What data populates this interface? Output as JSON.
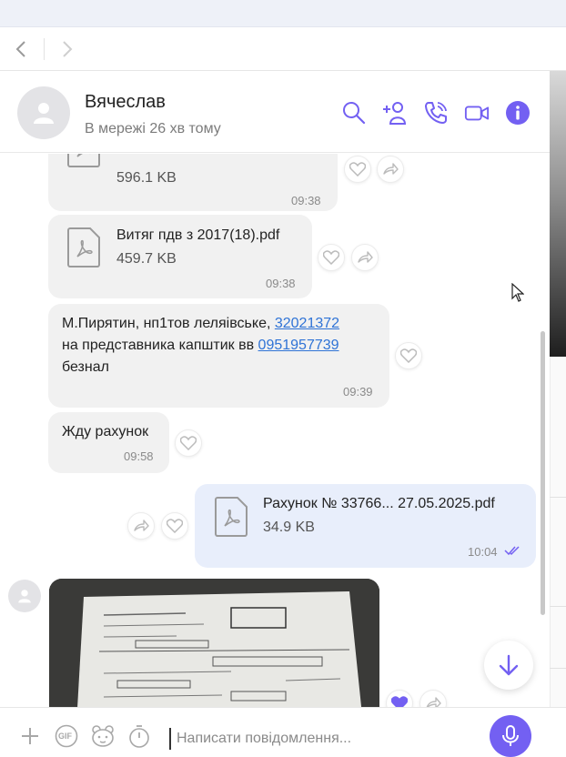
{
  "header": {
    "contact_name": "Вячеслав",
    "status": "В мережі 26 хв тому"
  },
  "messages": {
    "m1": {
      "size": "596.1 KB",
      "time": "09:38"
    },
    "m2": {
      "file_name": "Витяг пдв з 2017(18).pdf",
      "size": "459.7 KB",
      "time": "09:38"
    },
    "m3": {
      "line1_text": "М.Пирятин, нп1тов леляівське, ",
      "line1_link": "32021372",
      "line2_text": "на представника капштик вв ",
      "line2_link": "0951957739",
      "line3_text": "безнал",
      "time": "09:39"
    },
    "m4": {
      "text": "Жду рахунок",
      "time": "09:58"
    },
    "m5": {
      "file_name": "Рахунок № 33766... 27.05.2025.pdf",
      "size": "34.9 KB",
      "time": "10:04"
    }
  },
  "composer": {
    "placeholder": "Написати повідомлення...",
    "gif_label": "GIF"
  },
  "colors": {
    "accent": "#7360f2",
    "incoming_bubble": "#f1f1f1",
    "outgoing_bubble": "#e8eefb",
    "link": "#2f73d6"
  },
  "icons": [
    "back-arrow-icon",
    "forward-arrow-icon",
    "search-icon",
    "add-participant-icon",
    "voice-call-icon",
    "video-call-icon",
    "info-icon",
    "pdf-file-icon",
    "like-icon",
    "forward-icon",
    "read-ticks-icon",
    "scroll-down-icon",
    "plus-icon",
    "gif-icon",
    "sticker-icon",
    "timer-icon",
    "microphone-icon",
    "default-avatar-icon"
  ]
}
